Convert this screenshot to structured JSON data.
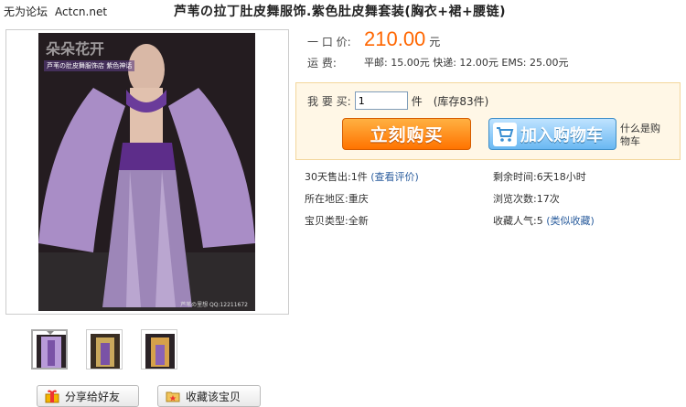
{
  "watermark": {
    "text": "无为论坛",
    "site": "Actcn.net"
  },
  "title": "芦苇の拉丁肚皮舞服饰.紫色肚皮舞套装(胸衣+裙+腰链)",
  "image": {
    "shop_logo": "朵朵花开",
    "shop_caption": "芦苇の肚皮舞服饰店 紫色神话",
    "footer": "芦苇の里想 QQ:12211672"
  },
  "price": {
    "label": "一 口 价:",
    "value": "210.00",
    "currency": "元"
  },
  "shipping": {
    "label": "运    费:",
    "text": "平邮: 15.00元 快递: 12.00元 EMS: 25.00元"
  },
  "buy": {
    "qty_label": "我 要 买:",
    "qty_value": "1",
    "qty_unit": "件",
    "stock": "(库存83件)",
    "buy_now": "立刻购买",
    "add_cart": "加入购物车",
    "what_cart": "什么是购物车"
  },
  "info": {
    "sold_label": "30天售出:",
    "sold_value": "1件",
    "reviews_link": "(查看评价)",
    "remain_label": "剩余时间:",
    "remain_value": "6天18小时",
    "region_label": "所在地区:",
    "region_value": "重庆",
    "views_label": "浏览次数:",
    "views_value": "17次",
    "type_label": "宝贝类型:",
    "type_value": "全新",
    "fav_label": "收藏人气:",
    "fav_value": "5",
    "similar_link": "(类似收藏)"
  },
  "actions": {
    "share": "分享给好友",
    "favorite": "收藏该宝贝"
  },
  "colors": {
    "price": "#ff6600",
    "buy_now": "#ff7300",
    "add_cart": "#6ab8f2",
    "link": "#2c5e9e"
  }
}
